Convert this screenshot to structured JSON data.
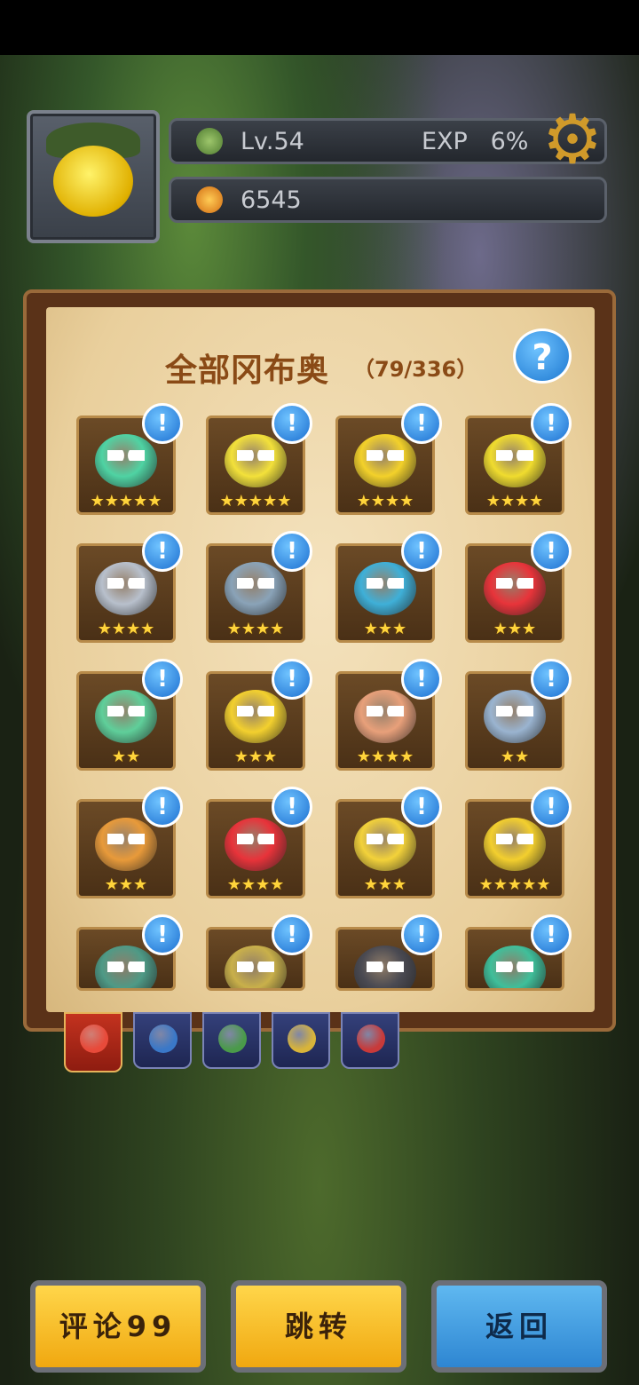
{
  "hud": {
    "level": "Lv.54",
    "exp_label": "EXP",
    "exp_value": "6%",
    "coins": "6545"
  },
  "panel": {
    "title": "全部冈布奥",
    "count": "（79/336）",
    "help": "?"
  },
  "cards": [
    {
      "stars": "★★★★★",
      "color": "#4fd3a3"
    },
    {
      "stars": "★★★★★",
      "color": "#f3e13a"
    },
    {
      "stars": "★★★★",
      "color": "#f3d12a"
    },
    {
      "stars": "★★★★",
      "color": "#f0dc2e"
    },
    {
      "stars": "★★★★",
      "color": "#b8c0cc"
    },
    {
      "stars": "★★★★",
      "color": "#8aa3b8"
    },
    {
      "stars": "★★★",
      "color": "#3fb0d8"
    },
    {
      "stars": "★★★",
      "color": "#e8343a"
    },
    {
      "stars": "★★",
      "color": "#5fcf9a"
    },
    {
      "stars": "★★★",
      "color": "#f3d02e"
    },
    {
      "stars": "★★★★",
      "color": "#e8a07a"
    },
    {
      "stars": "★★",
      "color": "#9ab4d0"
    },
    {
      "stars": "★★★",
      "color": "#e89a3a"
    },
    {
      "stars": "★★★★",
      "color": "#e8333a"
    },
    {
      "stars": "★★★",
      "color": "#f3d23a"
    },
    {
      "stars": "★★★★★",
      "color": "#f3cf2e"
    },
    {
      "stars": "",
      "color": "#4e9a86"
    },
    {
      "stars": "",
      "color": "#c9b04a"
    },
    {
      "stars": "",
      "color": "#4a4a52"
    },
    {
      "stars": "",
      "color": "#3fbf9a"
    }
  ],
  "badge_text": "!",
  "buttons": {
    "comment": "评论99",
    "jump": "跳转",
    "back": "返回"
  },
  "tabs": [
    {
      "name": "all",
      "color": "#e84a3a"
    },
    {
      "name": "blue",
      "color": "#3a78c8"
    },
    {
      "name": "green",
      "color": "#4a9a4a"
    },
    {
      "name": "yellow",
      "color": "#d8b43a"
    },
    {
      "name": "red",
      "color": "#c83a3a"
    }
  ]
}
